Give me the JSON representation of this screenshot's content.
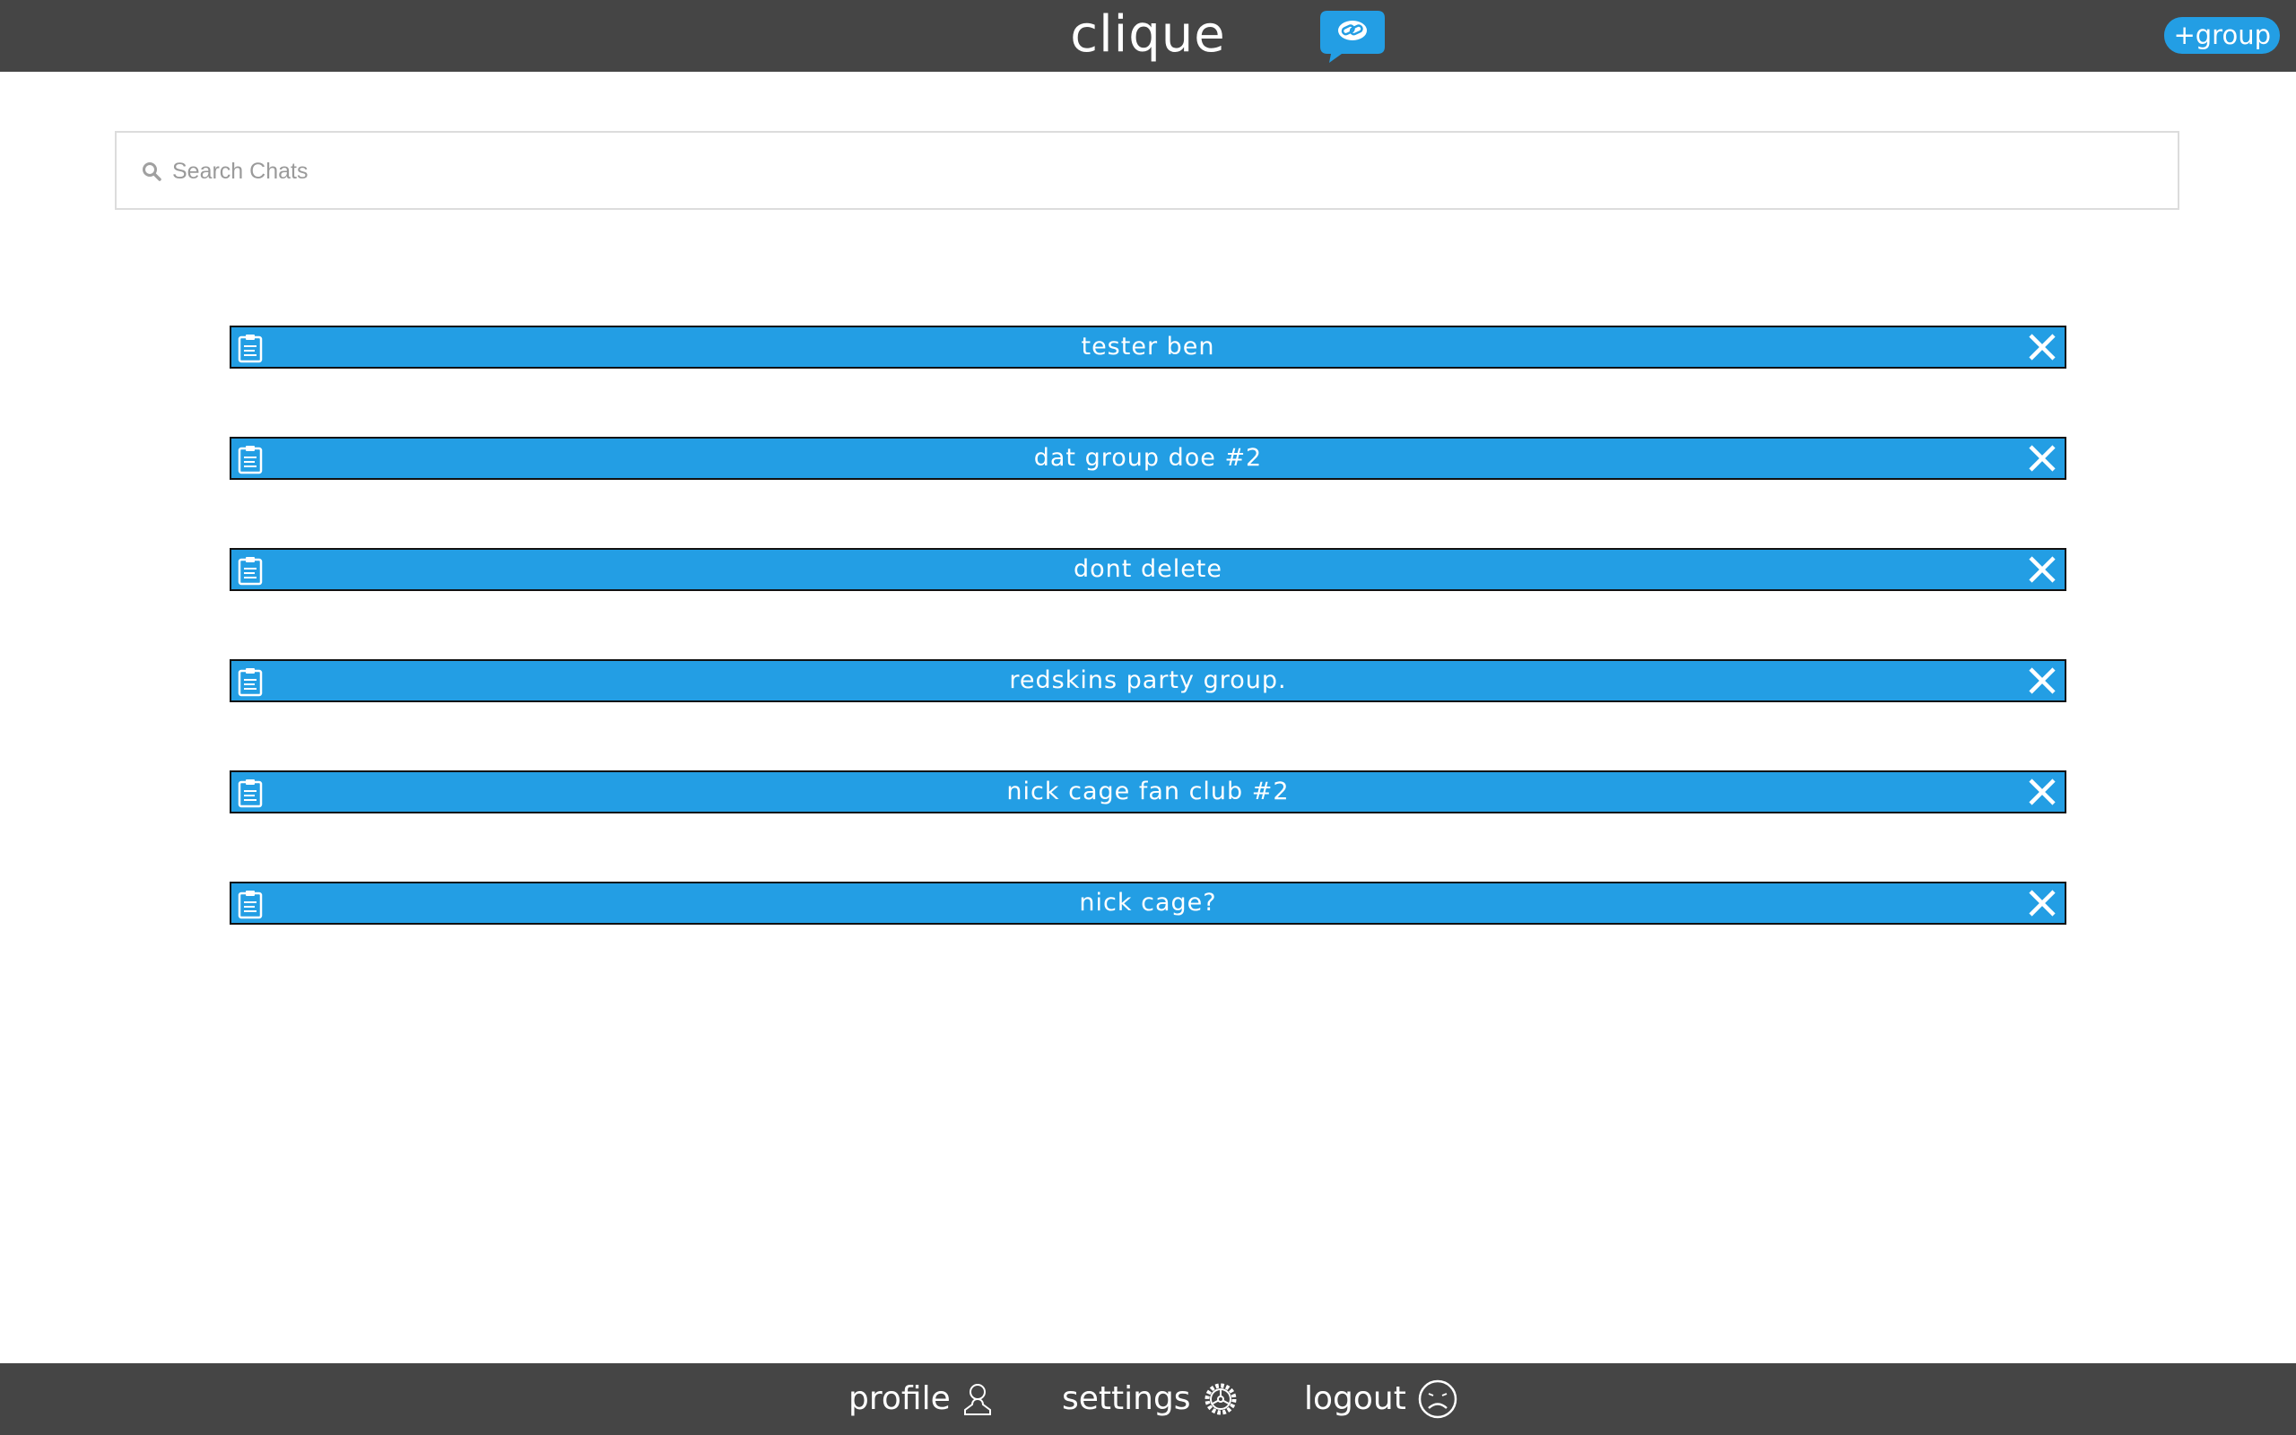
{
  "header": {
    "brand": "clique",
    "add_group_label": "+group"
  },
  "search": {
    "placeholder": "Search Chats",
    "value": ""
  },
  "chats": [
    {
      "name": "tester ben"
    },
    {
      "name": "dat group doe #2"
    },
    {
      "name": "dont delete"
    },
    {
      "name": "redskins party group."
    },
    {
      "name": "nick cage fan club #2"
    },
    {
      "name": "nick cage?"
    }
  ],
  "footer": {
    "profile_label": "profile",
    "settings_label": "settings",
    "logout_label": "logout"
  },
  "colors": {
    "bar_background": "#454545",
    "accent": "#239ee4",
    "row_border": "#111111"
  },
  "icons": {
    "brand": "chat-bubble-link-icon",
    "search": "search-icon",
    "chat_row": "clipboard-icon",
    "chat_delete": "close-icon",
    "profile": "user-icon",
    "settings": "gear-icon",
    "logout": "sad-face-icon"
  }
}
